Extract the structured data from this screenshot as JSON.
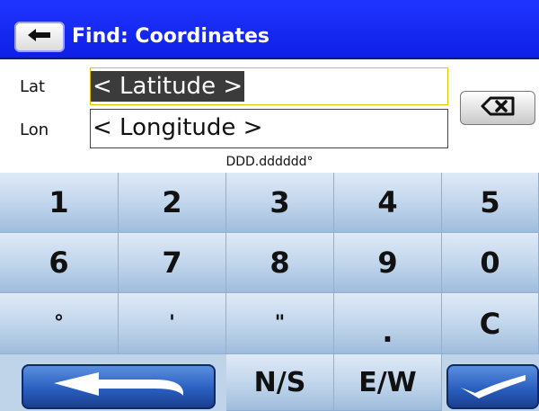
{
  "titlebar": {
    "title": "Find: Coordinates",
    "back_icon": "back-arrow-icon"
  },
  "fields": {
    "lat_label": "Lat",
    "lat_value": "< Latitude >",
    "lon_label": "Lon",
    "lon_value": "< Longitude >",
    "format_hint": "DDD.dddddd°"
  },
  "keypad": {
    "row1": [
      "1",
      "2",
      "3",
      "4",
      "5"
    ],
    "row2": [
      "6",
      "7",
      "8",
      "9",
      "0"
    ],
    "row3": [
      "°",
      "'",
      "\"",
      ".",
      "C"
    ],
    "row4": {
      "back_icon": "return-arrow-icon",
      "ns": "N/S",
      "ew": "E/W",
      "ok_icon": "checkmark-icon"
    }
  },
  "colors": {
    "titlebar": "#1428f5",
    "keypad_key": "#bfd4eb",
    "selection": "#3b3b3b"
  }
}
